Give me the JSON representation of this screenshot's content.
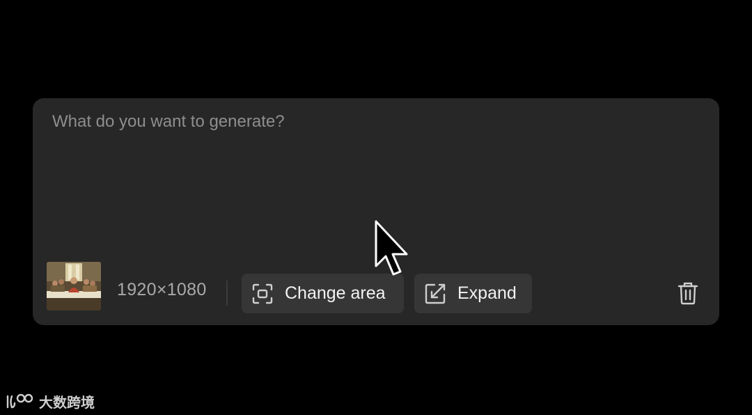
{
  "prompt": {
    "placeholder": "What do you want to generate?",
    "value": ""
  },
  "image": {
    "icon": "last-supper-thumbnail",
    "dimensions": "1920×1080"
  },
  "actions": {
    "change_area": {
      "label": "Change area",
      "icon": "crop-area-icon"
    },
    "expand": {
      "label": "Expand",
      "icon": "expand-arrow-icon"
    },
    "delete": {
      "icon": "trash-icon"
    }
  },
  "watermark": {
    "text": "大数跨境"
  },
  "colors": {
    "background": "#000000",
    "panel": "#272727",
    "button": "#363636",
    "placeholder": "#8e8e8e",
    "text": "#f2f2f2"
  }
}
